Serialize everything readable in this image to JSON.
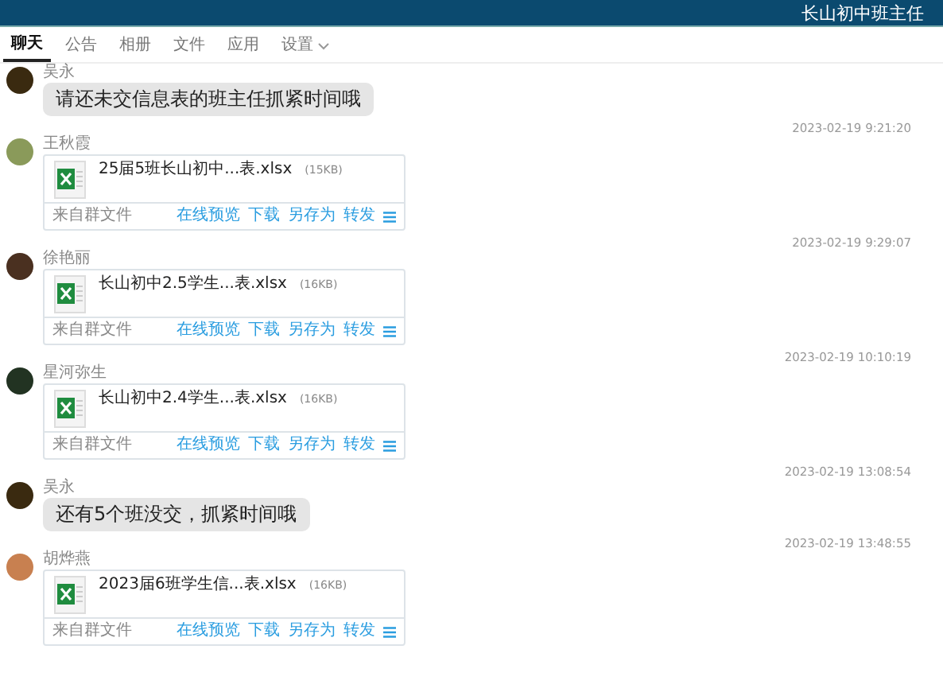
{
  "header": {
    "title": "长山初中班主任"
  },
  "tabs": [
    {
      "label": "聊天",
      "selected": true,
      "dropdown": false
    },
    {
      "label": "公告",
      "selected": false,
      "dropdown": false
    },
    {
      "label": "相册",
      "selected": false,
      "dropdown": false
    },
    {
      "label": "文件",
      "selected": false,
      "dropdown": false
    },
    {
      "label": "应用",
      "selected": false,
      "dropdown": false
    },
    {
      "label": "设置",
      "selected": false,
      "dropdown": true
    }
  ],
  "messages": [
    {
      "kind": "text",
      "sender": "吴永",
      "text": "请还未交信息表的班主任抓紧时间哦"
    },
    {
      "kind": "file",
      "time": "2023-02-19 9:21:20",
      "sender": "王秋霞",
      "file": "25届5班长山初中...表.xlsx",
      "size": "(15KB)",
      "source": "来自群文件",
      "actions": [
        "在线预览",
        "下载",
        "另存为",
        "转发"
      ]
    },
    {
      "kind": "file",
      "time": "2023-02-19 9:29:07",
      "sender": "徐艳丽",
      "file": "长山初中2.5学生...表.xlsx",
      "size": "(16KB)",
      "source": "来自群文件",
      "actions": [
        "在线预览",
        "下载",
        "另存为",
        "转发"
      ]
    },
    {
      "kind": "file",
      "time": "2023-02-19 10:10:19",
      "sender": "星河弥生",
      "file": "长山初中2.4学生...表.xlsx",
      "size": "(16KB)",
      "source": "来自群文件",
      "actions": [
        "在线预览",
        "下载",
        "另存为",
        "转发"
      ]
    },
    {
      "kind": "text",
      "time": "2023-02-19 13:08:54",
      "sender": "吴永",
      "text": "还有5个班没交，抓紧时间哦"
    },
    {
      "kind": "file",
      "time": "2023-02-19 13:48:55",
      "sender": "胡烨燕",
      "file": "2023届6班学生信...表.xlsx",
      "size": "(16KB)",
      "source": "来自群文件",
      "actions": [
        "在线预览",
        "下载",
        "另存为",
        "转发"
      ]
    }
  ]
}
